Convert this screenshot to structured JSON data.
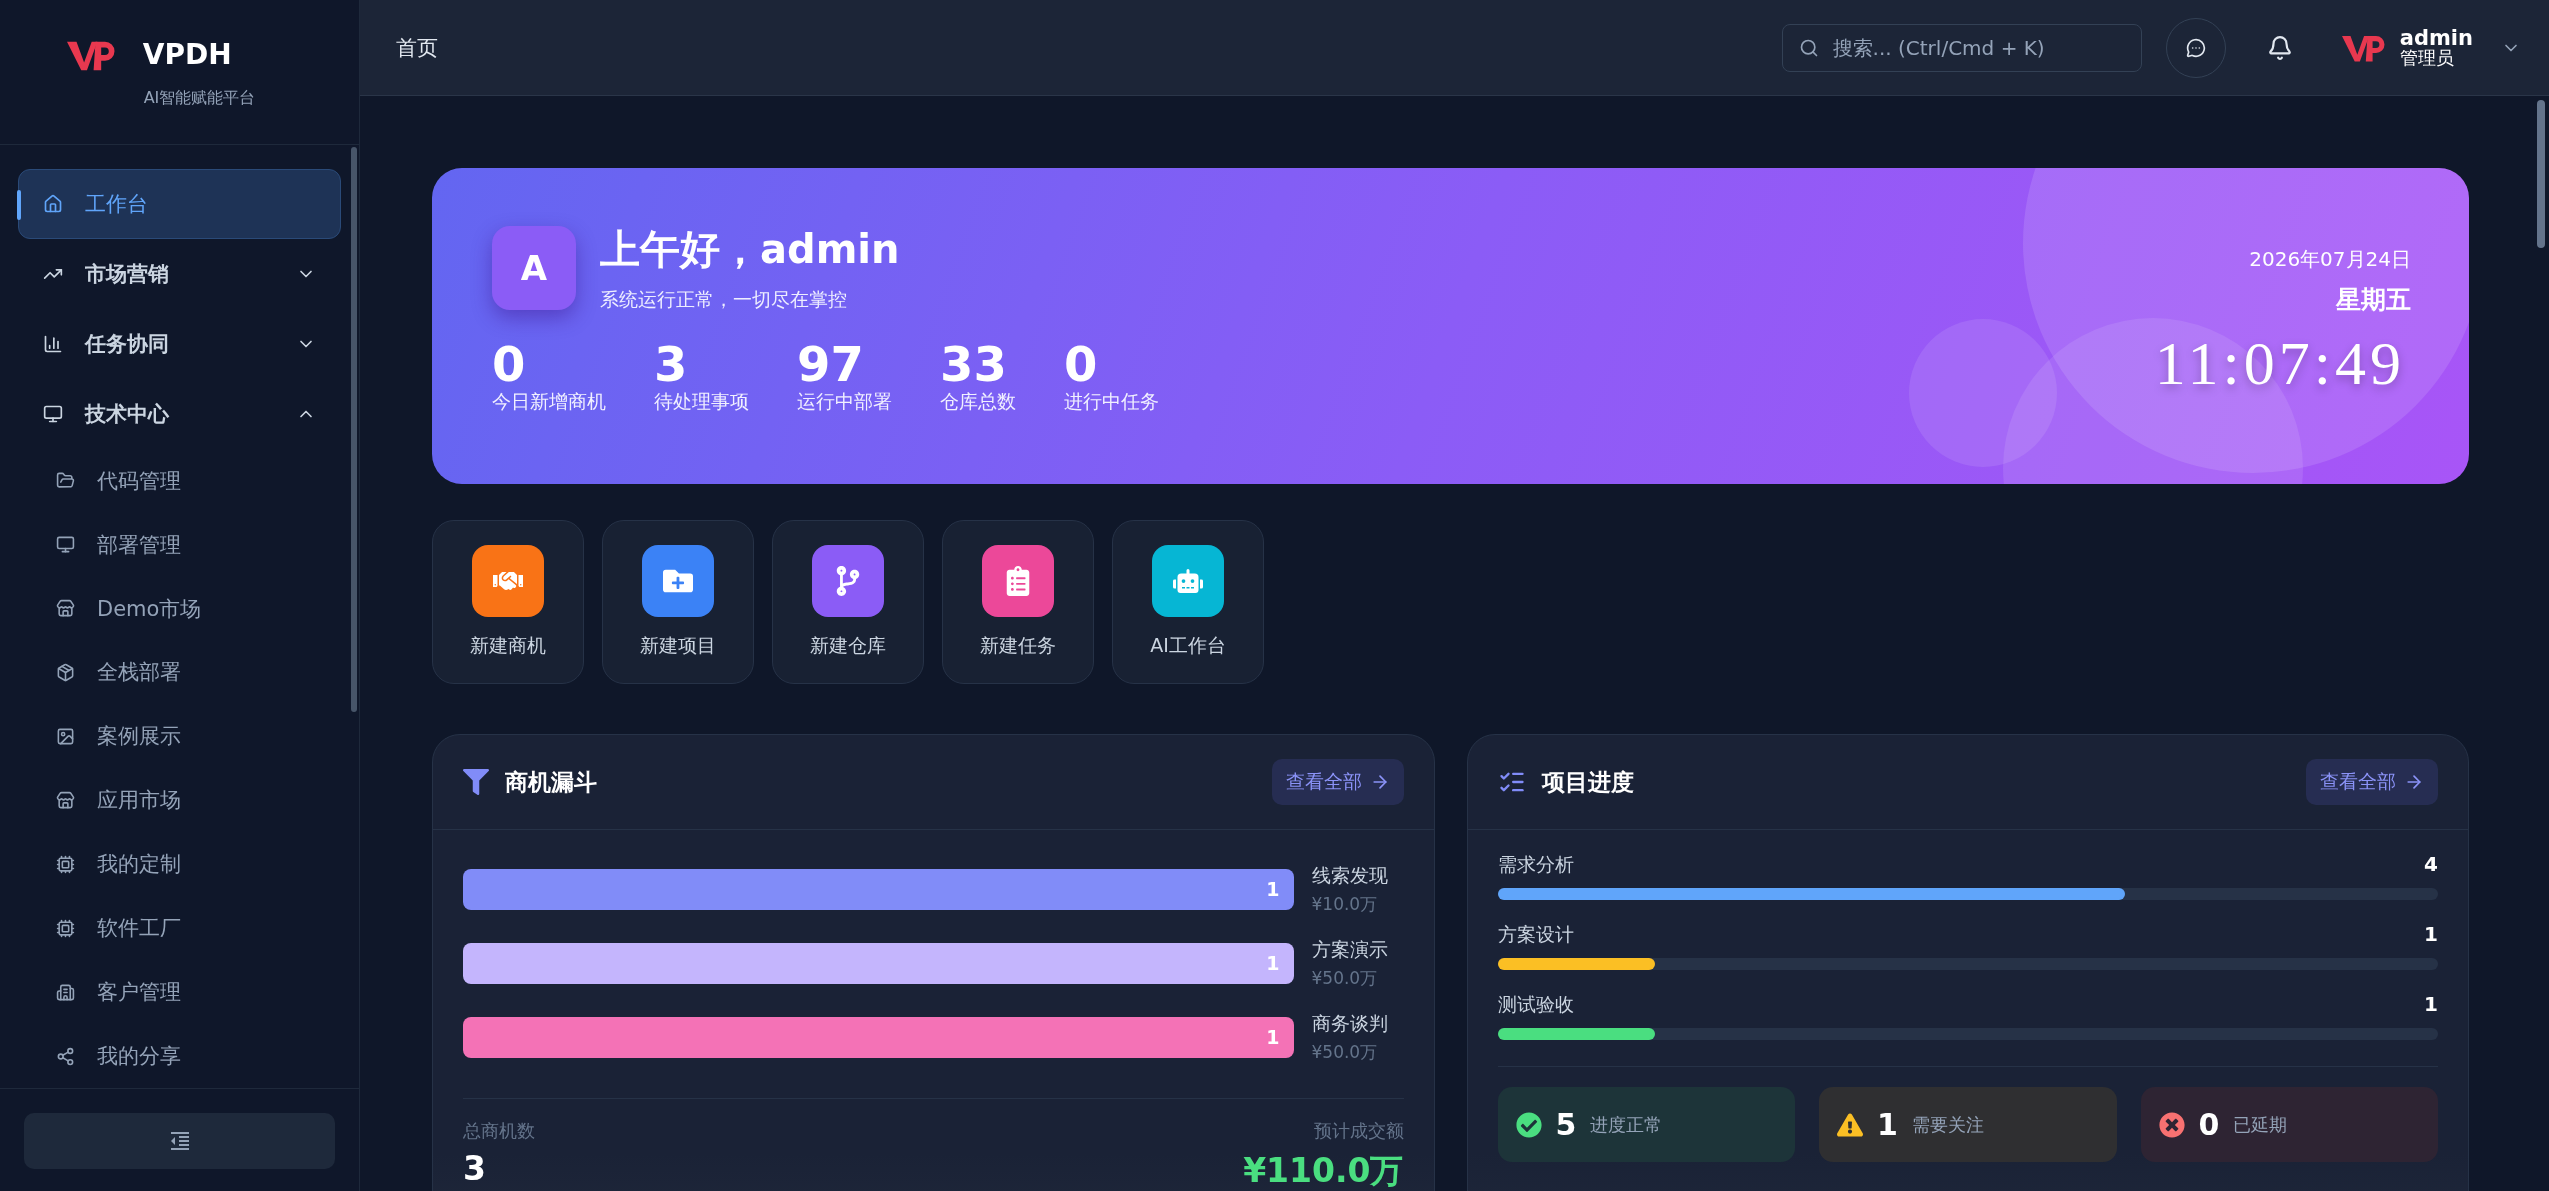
{
  "sidebar": {
    "brand": "VPDH",
    "tagline": "AI智能赋能平台",
    "items": [
      {
        "kind": "link",
        "label": "工作台",
        "selected": true
      },
      {
        "kind": "group",
        "label": "市场营销",
        "selected": false,
        "expanded": false
      },
      {
        "kind": "group",
        "label": "任务协同",
        "selected": false,
        "expanded": false
      },
      {
        "kind": "group",
        "label": "技术中心",
        "selected": false,
        "expanded": true,
        "children": [
          {
            "label": "代码管理",
            "selected": false
          },
          {
            "label": "部署管理",
            "selected": false
          },
          {
            "label": "Demo市场",
            "selected": false
          },
          {
            "label": "全栈部署",
            "selected": false
          },
          {
            "label": "案例展示",
            "selected": false
          },
          {
            "label": "应用市场",
            "selected": false
          },
          {
            "label": "我的定制",
            "selected": false
          },
          {
            "label": "软件工厂",
            "selected": false
          },
          {
            "label": "客户管理",
            "selected": false
          },
          {
            "label": "我的分享",
            "selected": false
          }
        ]
      }
    ]
  },
  "header": {
    "breadcrumb": "首页",
    "search": {
      "placeholder": "搜索... (Ctrl/Cmd + K)"
    },
    "user": {
      "name": "admin",
      "role": "管理员"
    }
  },
  "hero": {
    "avatar": "A",
    "greeting": "上午好，admin",
    "subtitle": "系统运行正常，一切尽在掌控",
    "date": "2026年07月24日",
    "weekday": "星期五",
    "time": "11:07:49",
    "stats": [
      {
        "value": "0",
        "label": "今日新增商机"
      },
      {
        "value": "3",
        "label": "待处理事项"
      },
      {
        "value": "97",
        "label": "运行中部署"
      },
      {
        "value": "33",
        "label": "仓库总数"
      },
      {
        "value": "0",
        "label": "进行中任务"
      }
    ]
  },
  "quick_actions": [
    {
      "label": "新建商机",
      "color": "#f97316"
    },
    {
      "label": "新建项目",
      "color": "#3b82f6"
    },
    {
      "label": "新建仓库",
      "color": "#8b5cf6"
    },
    {
      "label": "新建任务",
      "color": "#ec4899"
    },
    {
      "label": "AI工作台",
      "color": "#06b6d4"
    }
  ],
  "funnel": {
    "title": "商机漏斗",
    "view_all": "查看全部",
    "stages": [
      {
        "name": "线索发现",
        "amount": "¥10.0万",
        "count": "1",
        "color": "#818cf8"
      },
      {
        "name": "方案演示",
        "amount": "¥50.0万",
        "count": "1",
        "color": "#c4b5fd"
      },
      {
        "name": "商务谈判",
        "amount": "¥50.0万",
        "count": "1",
        "color": "#f472b6"
      }
    ],
    "total_label": "总商机数",
    "total": "3",
    "forecast_label": "预计成交额",
    "forecast": "¥110.0万"
  },
  "progress": {
    "title": "项目进度",
    "view_all": "查看全部",
    "stages": [
      {
        "name": "需求分析",
        "count": "4",
        "level": 0.667,
        "color": "#60a5fa"
      },
      {
        "name": "方案设计",
        "count": "1",
        "level": 0.167,
        "color": "#fbbf24"
      },
      {
        "name": "测试验收",
        "count": "1",
        "level": 0.167,
        "color": "#4ade80"
      }
    ],
    "statuses": [
      {
        "kind": "ok",
        "count": "5",
        "label": "进度正常"
      },
      {
        "kind": "warn",
        "count": "1",
        "label": "需要关注"
      },
      {
        "kind": "late",
        "count": "0",
        "label": "已延期"
      }
    ]
  }
}
